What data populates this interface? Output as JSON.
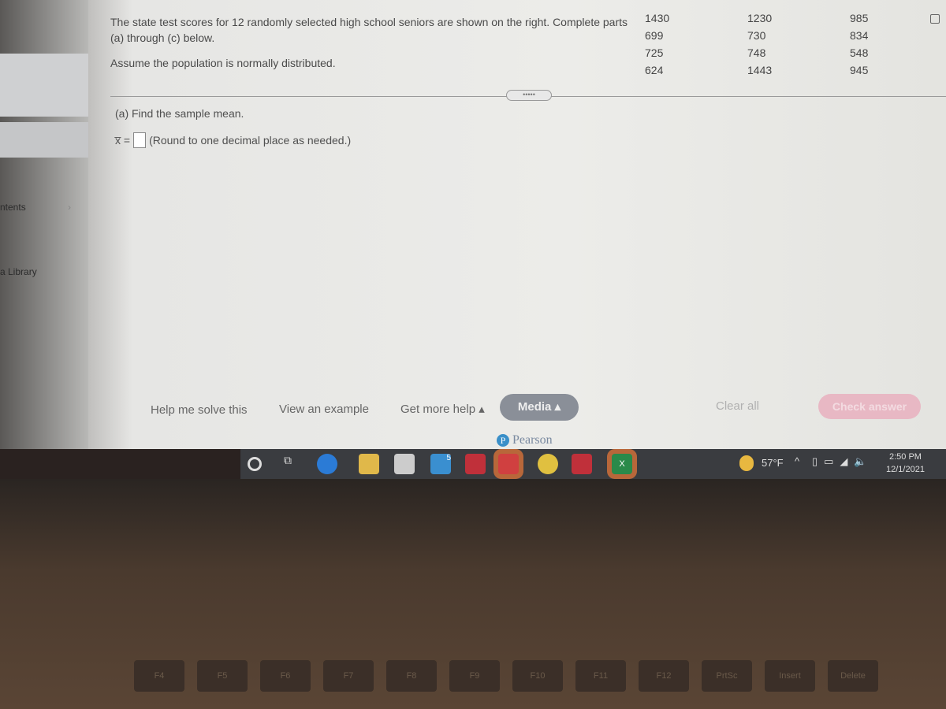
{
  "sidebar": {
    "items": [
      {
        "label": "ntents"
      },
      {
        "label": "a Library"
      }
    ]
  },
  "question": {
    "text": "The state test scores for 12 randomly selected high school seniors are shown on the right. Complete parts (a) through (c) below.",
    "assumption": "Assume the population is normally distributed."
  },
  "scores": {
    "col1": [
      "1430",
      "699",
      "725",
      "624"
    ],
    "col2": [
      "1230",
      "730",
      "748",
      "1443"
    ],
    "col3": [
      "985",
      "834",
      "548",
      "945"
    ]
  },
  "part_a": {
    "prompt": "(a) Find the sample mean.",
    "label": "x̅ =",
    "value": "",
    "hint": "(Round to one decimal place as needed.)"
  },
  "buttons": {
    "help": "Help me solve this",
    "example": "View an example",
    "more_help": "Get more help ▴",
    "media": "Media ▴",
    "clear": "Clear all",
    "check": "Check answer"
  },
  "brand": "Pearson",
  "taskbar": {
    "weather": "57°F",
    "time": "2:50 PM",
    "date": "12/1/2021",
    "mail_badge": "5"
  },
  "keys": [
    "F4",
    "F5",
    "F6",
    "F7",
    "F8",
    "F9",
    "F10",
    "F11",
    "F12",
    "PrtSc",
    "Insert",
    "Delete"
  ]
}
